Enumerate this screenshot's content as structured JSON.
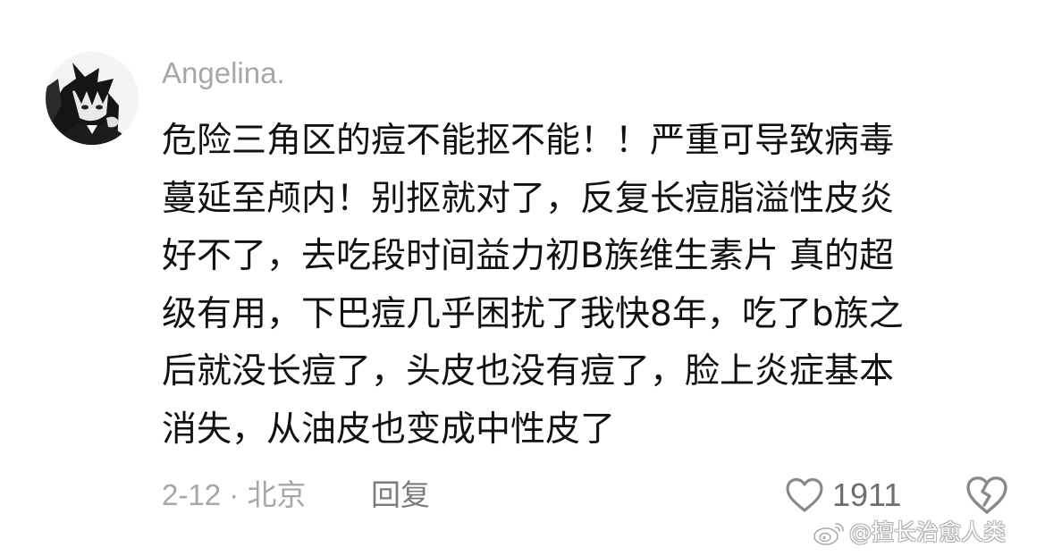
{
  "comment": {
    "username": "Angelina.",
    "text_lines": [
      "危险三角区的痘不能抠不能！！严重可导致病毒",
      "蔓延至颅内！别抠就对了，反复长痘脂溢性皮炎",
      "好不了，去吃段时间益力初B族维生素片 真的超",
      "级有用，下巴痘几乎困扰了我快8年，吃了b族之",
      "后就没长痘了，头皮也没有痘了，脸上炎症基本",
      "消失，从油皮也变成中性皮了"
    ],
    "date_location": "2-12 · 北京",
    "reply_label": "回复",
    "like_count": "1911"
  },
  "icons": {
    "avatar": "anime-avatar",
    "like": "heart-outline-icon",
    "dislike": "broken-heart-icon",
    "watermark_logo": "weibo-logo-icon"
  },
  "watermark": {
    "text": "@擅长治愈人类"
  },
  "colors": {
    "background": "#ffffff",
    "text_primary": "#111111",
    "text_secondary": "#a7a7a7",
    "icon": "#8a8a8a"
  }
}
